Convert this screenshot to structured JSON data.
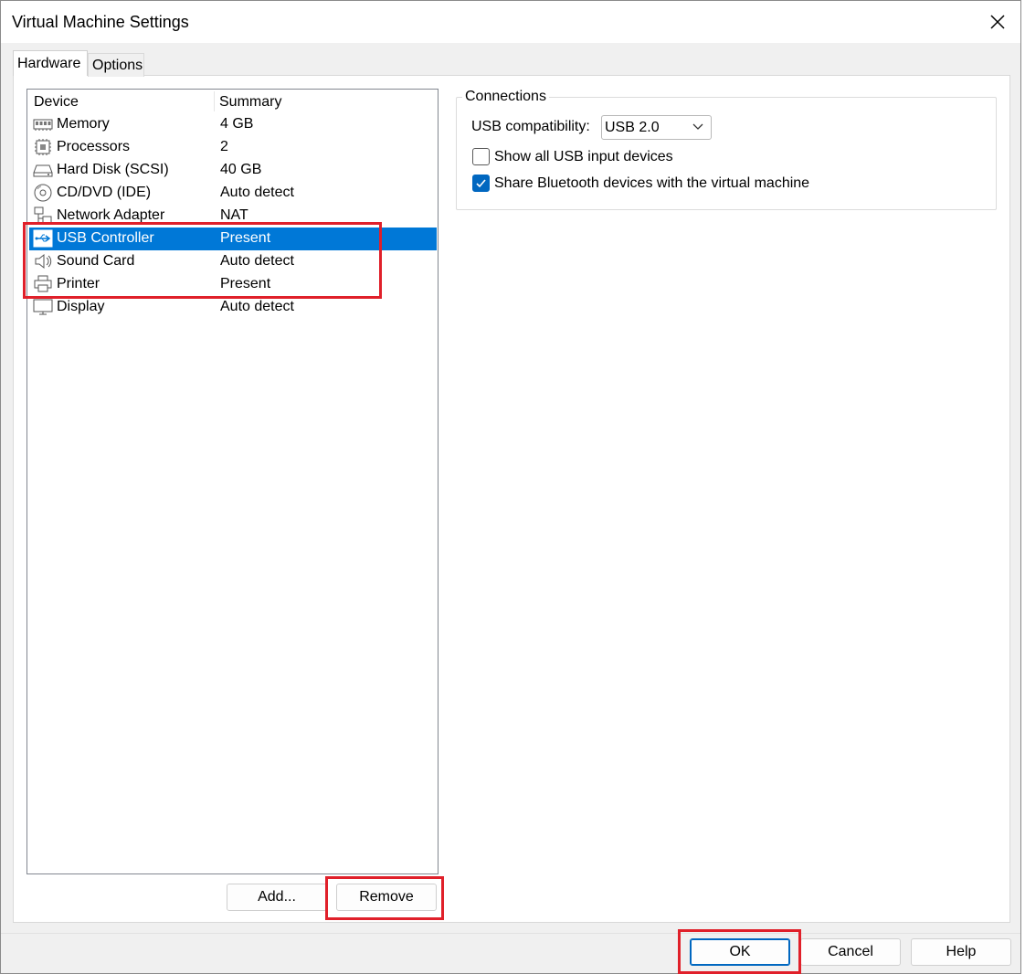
{
  "window": {
    "title": "Virtual Machine Settings"
  },
  "tabs": [
    {
      "label": "Hardware",
      "active": true
    },
    {
      "label": "Options",
      "active": false
    }
  ],
  "device_list": {
    "columns": [
      "Device",
      "Summary"
    ],
    "rows": [
      {
        "name": "Memory",
        "summary": "4 GB",
        "icon": "memory-icon"
      },
      {
        "name": "Processors",
        "summary": "2",
        "icon": "processor-icon"
      },
      {
        "name": "Hard Disk (SCSI)",
        "summary": "40 GB",
        "icon": "hard-disk-icon"
      },
      {
        "name": "CD/DVD (IDE)",
        "summary": "Auto detect",
        "icon": "cd-dvd-icon"
      },
      {
        "name": "Network Adapter",
        "summary": "NAT",
        "icon": "network-icon"
      },
      {
        "name": "USB Controller",
        "summary": "Present",
        "icon": "usb-icon",
        "selected": true
      },
      {
        "name": "Sound Card",
        "summary": "Auto detect",
        "icon": "speaker-icon"
      },
      {
        "name": "Printer",
        "summary": "Present",
        "icon": "printer-icon"
      },
      {
        "name": "Display",
        "summary": "Auto detect",
        "icon": "display-icon"
      }
    ]
  },
  "list_buttons": {
    "add": "Add...",
    "remove": "Remove"
  },
  "connections": {
    "group_label": "Connections",
    "usb_compat_label": "USB compatibility:",
    "usb_compat_value": "USB 2.0",
    "show_all_usb": {
      "label": "Show all USB input devices",
      "checked": false
    },
    "share_bluetooth": {
      "label": "Share Bluetooth devices with the virtual machine",
      "checked": true
    }
  },
  "dialog_buttons": {
    "ok": "OK",
    "cancel": "Cancel",
    "help": "Help"
  },
  "colors": {
    "selection": "#0078d7",
    "annotation": "#e0202a",
    "checkbox_checked": "#0067c0"
  }
}
